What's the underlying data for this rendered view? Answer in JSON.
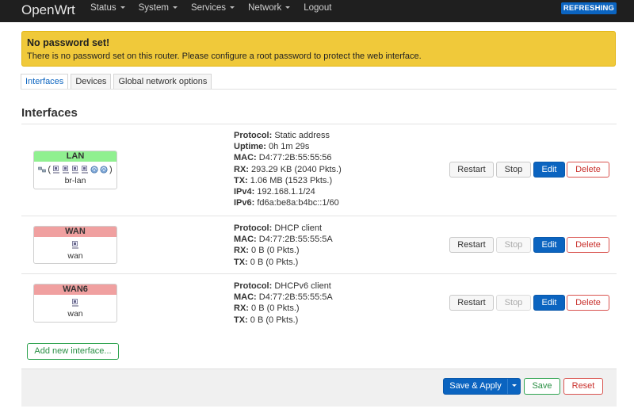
{
  "navbar": {
    "brand": "OpenWrt",
    "menu": [
      "Status",
      "System",
      "Services",
      "Network",
      "Logout"
    ],
    "status_badge": "REFRESHING"
  },
  "alert": {
    "title": "No password set!",
    "text": "There is no password set on this router. Please configure a root password to protect the web interface."
  },
  "tabs": [
    "Interfaces",
    "Devices",
    "Global network options"
  ],
  "section_title": "Interfaces",
  "interfaces": [
    {
      "name": "LAN",
      "device": "br-lan",
      "lines": [
        {
          "label": "Protocol:",
          "value": "Static address"
        },
        {
          "label": "Uptime:",
          "value": "0h 1m 29s"
        },
        {
          "label": "MAC:",
          "value": "D4:77:2B:55:55:56"
        },
        {
          "label": "RX:",
          "value": "293.29 KB (2040 Pkts.)"
        },
        {
          "label": "TX:",
          "value": "1.06 MB (1523 Pkts.)"
        },
        {
          "label": "IPv4:",
          "value": "192.168.1.1/24"
        },
        {
          "label": "IPv6:",
          "value": "fd6a:be8a:b4bc::1/60"
        }
      ]
    },
    {
      "name": "WAN",
      "device": "wan",
      "lines": [
        {
          "label": "Protocol:",
          "value": "DHCP client"
        },
        {
          "label": "MAC:",
          "value": "D4:77:2B:55:55:5A"
        },
        {
          "label": "RX:",
          "value": "0 B (0 Pkts.)"
        },
        {
          "label": "TX:",
          "value": "0 B (0 Pkts.)"
        }
      ]
    },
    {
      "name": "WAN6",
      "device": "wan",
      "lines": [
        {
          "label": "Protocol:",
          "value": "DHCPv6 client"
        },
        {
          "label": "MAC:",
          "value": "D4:77:2B:55:55:5A"
        },
        {
          "label": "RX:",
          "value": "0 B (0 Pkts.)"
        },
        {
          "label": "TX:",
          "value": "0 B (0 Pkts.)"
        }
      ]
    }
  ],
  "row_buttons": {
    "restart": "Restart",
    "stop": "Stop",
    "edit": "Edit",
    "delete": "Delete"
  },
  "add_interface_label": "Add new interface...",
  "footer": {
    "save_apply": "Save & Apply",
    "save": "Save",
    "reset": "Reset"
  },
  "colors": {
    "accent": "#0b64c0",
    "lan": "#90f090",
    "wan": "#f0a0a0",
    "alert": "#f0c93a"
  }
}
